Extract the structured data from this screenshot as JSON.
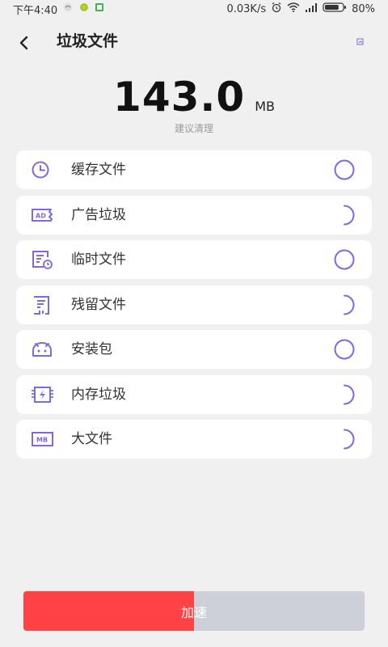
{
  "status_bar": {
    "time": "下午4:40",
    "network_speed": "0.03K/s",
    "battery": "80%",
    "battery_level": 0.8
  },
  "header": {
    "title": "垃圾文件",
    "back_icon": "chevron-left-icon",
    "corner_icon": "small-gallery-icon"
  },
  "summary": {
    "size": "143.0",
    "unit": "MB",
    "hint": "建议清理"
  },
  "items": [
    {
      "label": "缓存文件",
      "icon": "clock-icon",
      "state": "done"
    },
    {
      "label": "广告垃圾",
      "icon": "ad-icon",
      "state": "scanning"
    },
    {
      "label": "临时文件",
      "icon": "temp-file-icon",
      "state": "done"
    },
    {
      "label": "残留文件",
      "icon": "residual-file-icon",
      "state": "scanning"
    },
    {
      "label": "安装包",
      "icon": "android-icon",
      "state": "done"
    },
    {
      "label": "内存垃圾",
      "icon": "memory-chip-icon",
      "state": "scanning"
    },
    {
      "label": "大文件",
      "icon": "mb-file-icon",
      "state": "scanning"
    }
  ],
  "action": {
    "label": "加速",
    "progress": 0.5
  },
  "colors": {
    "accent": "#7a6be0",
    "button_fill": "#ff4245",
    "button_track": "#cdd0d9",
    "background": "#f0f0f0"
  }
}
